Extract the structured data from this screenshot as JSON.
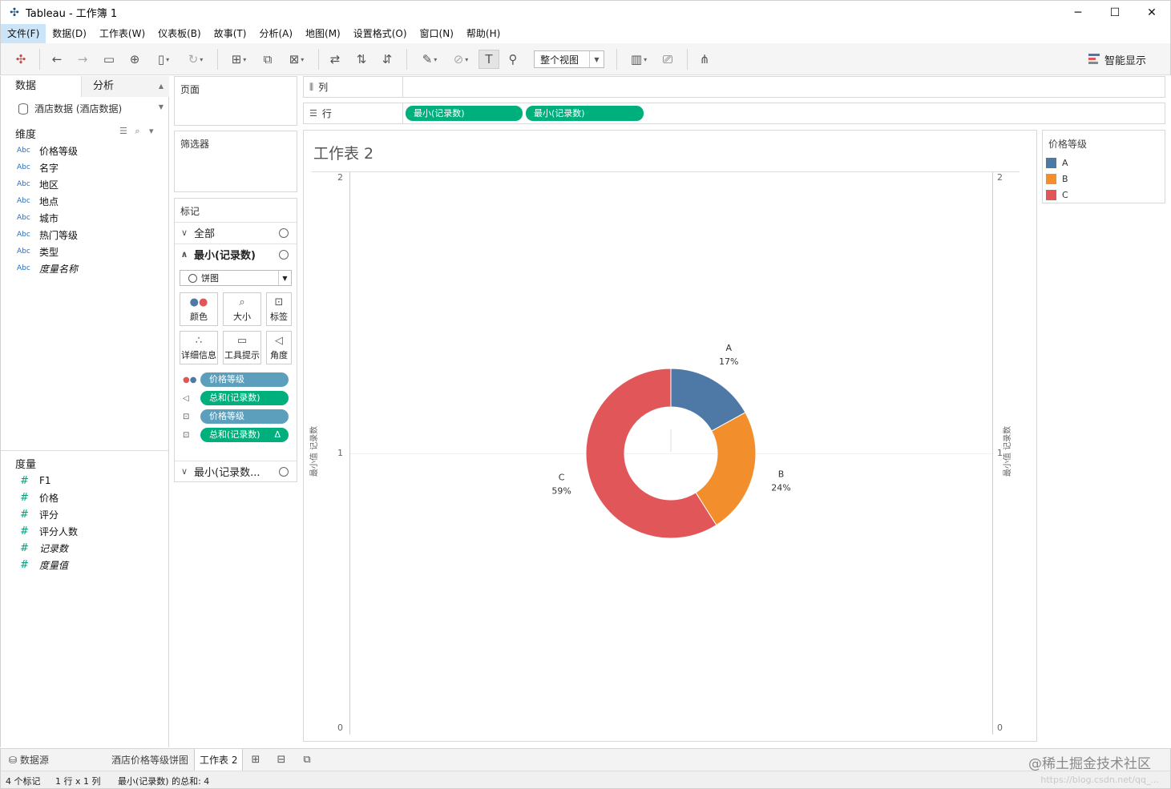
{
  "window": {
    "title": "Tableau - 工作簿 1",
    "minimize": "─",
    "maximize": "☐",
    "close": "✕"
  },
  "menu": [
    "文件(F)",
    "数据(D)",
    "工作表(W)",
    "仪表板(B)",
    "故事(T)",
    "分析(A)",
    "地图(M)",
    "设置格式(O)",
    "窗口(N)",
    "帮助(H)"
  ],
  "toolbar": {
    "fit": "整个视图",
    "show_me": "智能显示"
  },
  "data_pane": {
    "tab_data": "数据",
    "tab_analysis": "分析",
    "datasource": "酒店数据 (酒店数据)",
    "dimensions_label": "维度",
    "dimensions": [
      "价格等级",
      "名字",
      "地区",
      "地点",
      "城市",
      "热门等级",
      "类型",
      "度量名称"
    ],
    "measures_label": "度量",
    "measures": [
      "F1",
      "价格",
      "评分",
      "评分人数",
      "记录数",
      "度量值"
    ],
    "abc": "Abc",
    "hash": "#"
  },
  "cards": {
    "pages": "页面",
    "filters": "筛选器",
    "marks": "标记",
    "all": "全部",
    "min_records": "最小(记录数)",
    "mark_type": "饼图",
    "btn_color": "颜色",
    "btn_size": "大小",
    "btn_label": "标签",
    "btn_detail": "详细信息",
    "btn_tooltip": "工具提示",
    "btn_angle": "角度",
    "pill1": "价格等级",
    "pill2": "总和(记录数)",
    "pill3": "价格等级",
    "pill4": "总和(记录数)",
    "pill4_delta": "Δ",
    "min_records2": "最小(记录数..."
  },
  "shelves": {
    "columns_label": "列",
    "rows_label": "行",
    "row_pill1": "最小(记录数)",
    "row_pill2": "最小(记录数)"
  },
  "view": {
    "title": "工作表 2",
    "axis_title": "最小值 记录数",
    "ticks_left": [
      "2",
      "1",
      "0"
    ],
    "ticks_right": [
      "2",
      "1",
      "0"
    ]
  },
  "chart_data": {
    "type": "pie",
    "categories": [
      "A",
      "B",
      "C"
    ],
    "values": [
      17,
      24,
      59
    ],
    "labels": [
      "17%",
      "24%",
      "59%"
    ],
    "colors": [
      "#4e79a7",
      "#f28e2b",
      "#e15759"
    ],
    "ylim": [
      0,
      2
    ],
    "ylabel": "最小值 记录数"
  },
  "legend": {
    "title": "价格等级",
    "items": [
      {
        "label": "A",
        "color": "#4e79a7"
      },
      {
        "label": "B",
        "color": "#f28e2b"
      },
      {
        "label": "C",
        "color": "#e15759"
      }
    ]
  },
  "tabs": {
    "datasource": "数据源",
    "sheet1": "酒店价格等级饼图",
    "sheet2": "工作表 2"
  },
  "status": {
    "marks": "4 个标记",
    "rows_cols": "1 行 x 1 列",
    "sum": "最小(记录数) 的总和: 4"
  },
  "watermark": "@稀土掘金技术社区",
  "url_fragment": "https://blog.csdn.net/qq_..."
}
